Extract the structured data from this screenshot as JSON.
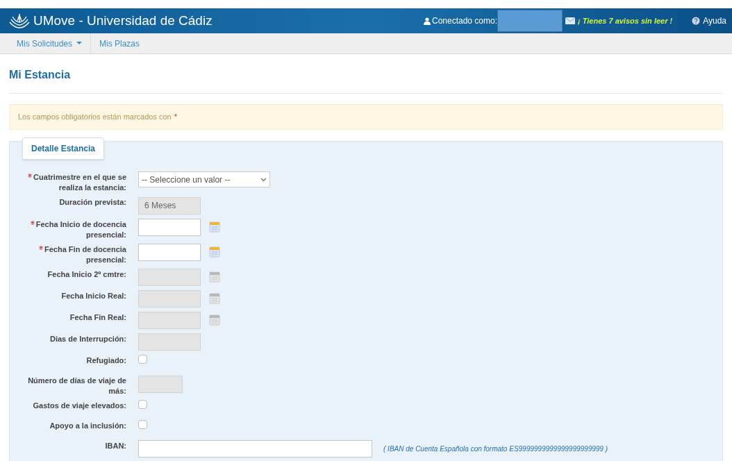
{
  "header": {
    "title": "UMove - Universidad de Cádiz",
    "connected_label": "Conectado como:",
    "notices": "¡ Tienes 7 avisos sin leer !",
    "help": "Ayuda"
  },
  "nav": [
    {
      "label": "Mis Solicitudes",
      "dropdown": true
    },
    {
      "label": "Mis Plazas",
      "dropdown": false
    }
  ],
  "page_title": "Mi Estancia",
  "alert": {
    "text": "Los campos obligatorios están marcados con",
    "mark": "*"
  },
  "fieldset": {
    "legend": "Detalle Estancia",
    "fields": [
      {
        "kind": "select",
        "label": "Cuatrimestre en el que se realiza la estancia:",
        "required": true,
        "value": "-- Seleccione un valor --"
      },
      {
        "kind": "text",
        "label": "Duración prevista:",
        "required": false,
        "disabled": true,
        "value": "6 Meses"
      },
      {
        "kind": "date",
        "label": "Fecha Inicio de docencia presencial:",
        "required": true,
        "disabled": false
      },
      {
        "kind": "date",
        "label": "Fecha Fin de docencia presencial:",
        "required": true,
        "disabled": false
      },
      {
        "kind": "date",
        "label": "Fecha Inicio 2º cmtre:",
        "required": false,
        "disabled": true
      },
      {
        "kind": "date",
        "label": "Fecha Inicio Real:",
        "required": false,
        "disabled": true
      },
      {
        "kind": "date",
        "label": "Fecha Fin Real:",
        "required": false,
        "disabled": true
      },
      {
        "kind": "text",
        "label": "Dias de Interrupción:",
        "required": false,
        "disabled": true
      },
      {
        "kind": "checkbox",
        "label": "Refugiado:",
        "required": false,
        "checked": false
      },
      {
        "kind": "short",
        "label": "Número de días de viaje de más:",
        "required": false,
        "disabled": true
      },
      {
        "kind": "checkbox",
        "label": "Gastos de viaje elevados:",
        "required": false,
        "checked": false
      },
      {
        "kind": "checkbox",
        "label": "Apoyo a la inclusión:",
        "required": false,
        "checked": false
      },
      {
        "kind": "wide",
        "label": "IBAN:",
        "required": false,
        "disabled": false,
        "hint": "( IBAN de Cuenta Española con formato ES9999999999999999999999 )"
      }
    ]
  }
}
